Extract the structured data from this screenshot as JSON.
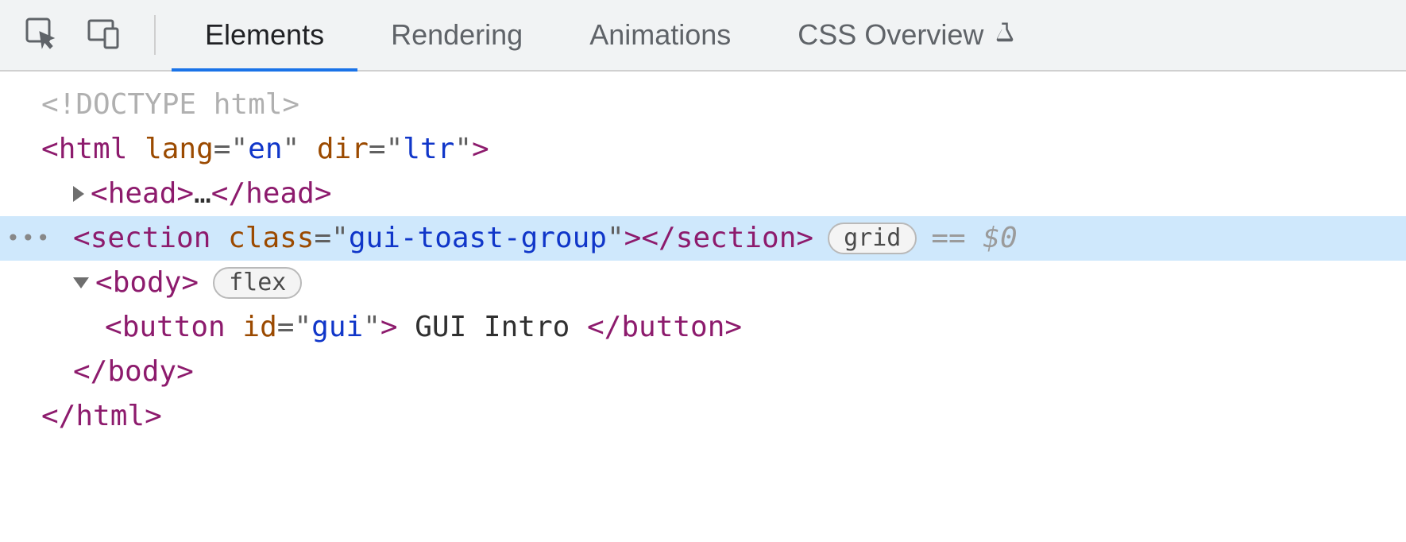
{
  "toolbar": {
    "tabs": [
      {
        "label": "Elements",
        "active": true
      },
      {
        "label": "Rendering",
        "active": false
      },
      {
        "label": "Animations",
        "active": false
      },
      {
        "label": "CSS Overview",
        "active": false,
        "icon": "flask-icon"
      }
    ]
  },
  "dom": {
    "doctype": "<!DOCTYPE html>",
    "html_tag": "html",
    "html_attrs": [
      {
        "name": "lang",
        "value": "en"
      },
      {
        "name": "dir",
        "value": "ltr"
      }
    ],
    "head_tag": "head",
    "head_ellipsis": "…",
    "section_tag": "section",
    "section_attr_name": "class",
    "section_attr_value": "gui-toast-group",
    "section_badge": "grid",
    "section_ref": "== $0",
    "body_tag": "body",
    "body_badge": "flex",
    "button_tag": "button",
    "button_attr_name": "id",
    "button_attr_value": "gui",
    "button_text": " GUI Intro ",
    "close_body": "body",
    "close_html": "html"
  }
}
